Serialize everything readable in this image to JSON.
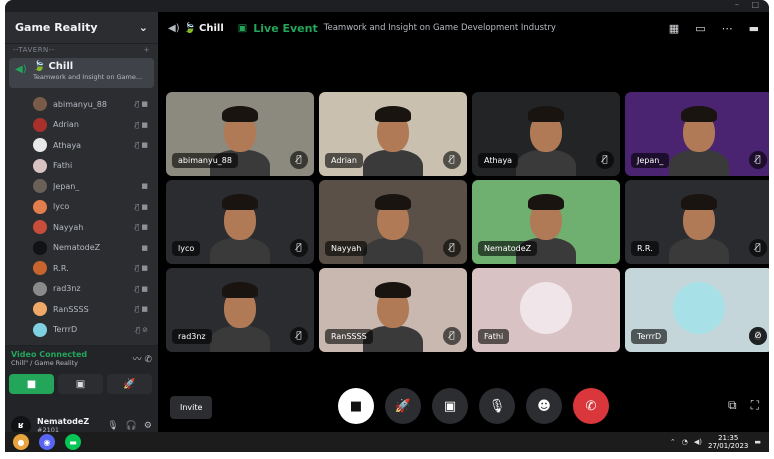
{
  "window": {
    "controls": [
      "–",
      "□"
    ]
  },
  "sidebar": {
    "server_name": "Game Reality",
    "category": "--TAVERN--",
    "voice_channel": {
      "name": "Chill",
      "topic": "Teamwork and Insight on Game..."
    },
    "members": [
      {
        "name": "abimanyu_88",
        "icons": "🎙̸ ■",
        "color": "#7a5a48"
      },
      {
        "name": "Adrian",
        "icons": "🎙̸ ■",
        "color": "#a8322b"
      },
      {
        "name": "Athaya",
        "icons": "🎙̸ ■",
        "color": "#e8e8e8"
      },
      {
        "name": "Fathi",
        "icons": "",
        "color": "#d9c2c2"
      },
      {
        "name": "Jepan_",
        "icons": "■",
        "color": "#6a6058"
      },
      {
        "name": "lyco",
        "icons": "🎙̸ ■",
        "color": "#e27d4e"
      },
      {
        "name": "Nayyah",
        "icons": "🎙̸ ■",
        "color": "#c94d3b"
      },
      {
        "name": "NematodeZ",
        "icons": "■",
        "color": "#111214"
      },
      {
        "name": "R.R.",
        "icons": "🎙̸ ■",
        "color": "#c8642d"
      },
      {
        "name": "rad3nz",
        "icons": "🎙̸ ■",
        "color": "#8a8a8a"
      },
      {
        "name": "RanSSSS",
        "icons": "🎙̸ ■",
        "color": "#f0a868"
      },
      {
        "name": "TerrrD",
        "icons": "🎙̸ ⊘",
        "color": "#7fd0e0"
      }
    ],
    "voice_status": "Video Connected",
    "voice_location": "Chill\" / Game Reality",
    "user": {
      "name": "NematodeZ",
      "tag": "#2101",
      "initials": "ʁ"
    }
  },
  "topbar": {
    "channel": "Chill",
    "live_label": "Live Event",
    "topic": "Teamwork and Insight on Game Development Industry"
  },
  "tiles": [
    {
      "name": "abimanyu_88",
      "bg": "#8c8a7e",
      "face": true
    },
    {
      "name": "Adrian",
      "bg": "#c9c0b0",
      "face": true
    },
    {
      "name": "Athaya",
      "bg": "#222426",
      "face": true
    },
    {
      "name": "Jepan_",
      "bg": "#4a2470",
      "face": true
    },
    {
      "name": "lyco",
      "bg": "#2a2c30",
      "face": true
    },
    {
      "name": "Nayyah",
      "bg": "#5a5048",
      "face": true
    },
    {
      "name": "NematodeZ",
      "bg": "#6fb070",
      "face": true,
      "nomute": true
    },
    {
      "name": "R.R.",
      "bg": "#2a2c30",
      "face": true
    },
    {
      "name": "rad3nz",
      "bg": "#2a2c30",
      "face": true
    },
    {
      "name": "RanSSSS",
      "bg": "#c8b8b0",
      "face": true
    },
    {
      "name": "Fathi",
      "bg": "#d9c2c4",
      "face": false,
      "nomute": true
    },
    {
      "name": "TerrrD",
      "bg": "#c4d6da",
      "face": false,
      "deaf": true
    }
  ],
  "bottombar": {
    "invite_label": "Invite"
  },
  "taskbar": {
    "time": "21:35",
    "date": "27/01/2023"
  }
}
